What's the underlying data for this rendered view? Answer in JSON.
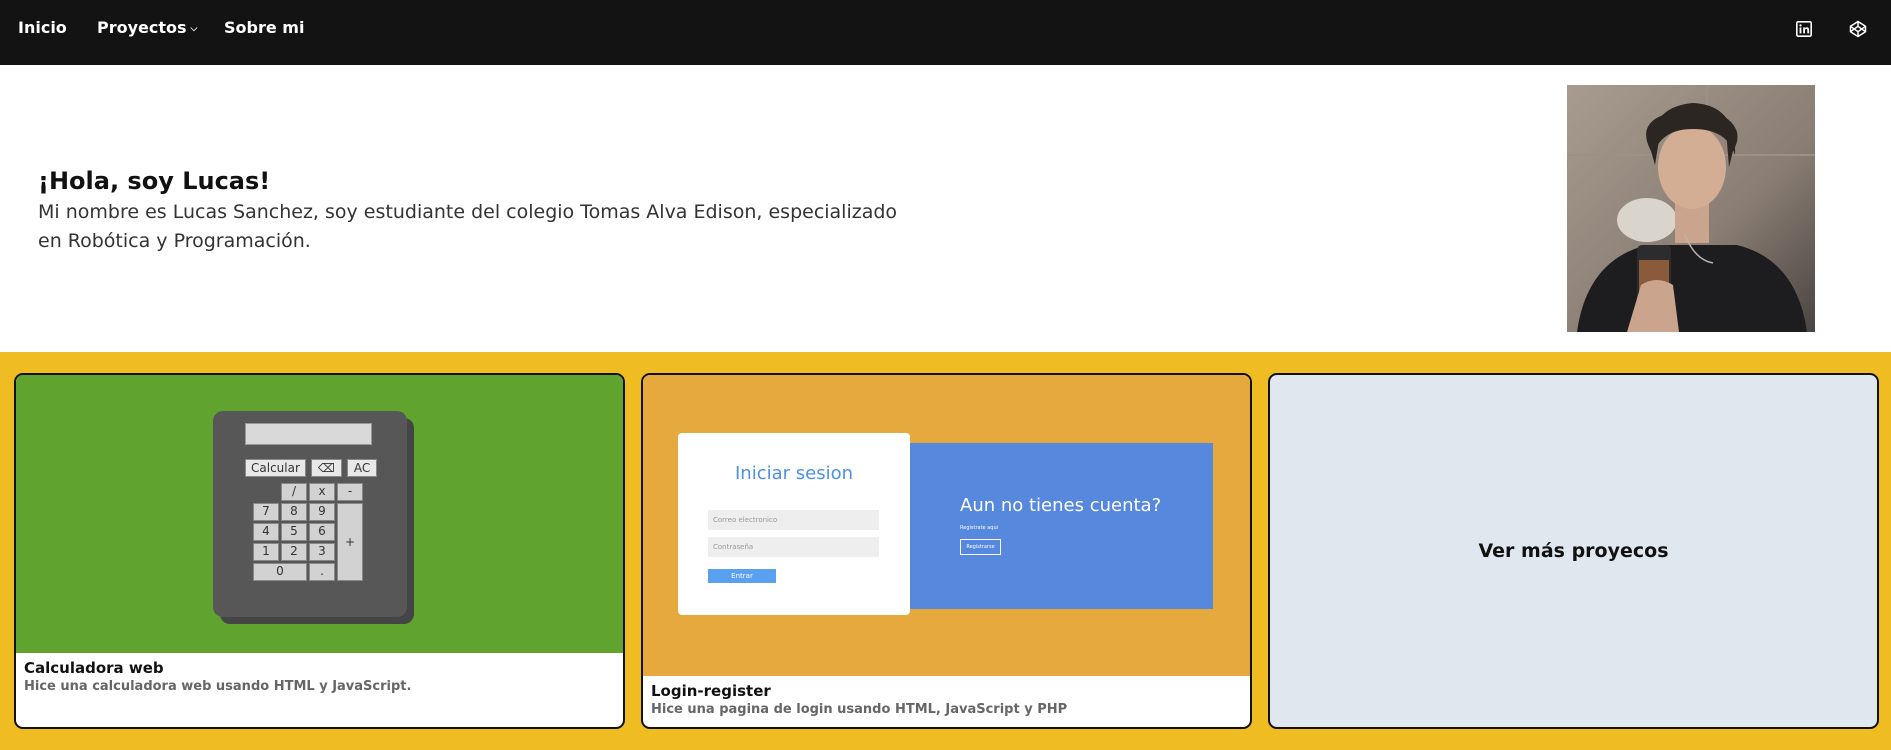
{
  "nav": {
    "home": "Inicio",
    "projects": "Proyectos",
    "about": "Sobre mi",
    "icons": [
      "linkedin-icon",
      "codepen-icon"
    ]
  },
  "hero": {
    "title": "¡Hola, soy Lucas!",
    "description": "Mi nombre es Lucas Sanchez, soy estudiante del colegio Tomas Alva Edison, especializado en Robótica y Programación."
  },
  "cards": [
    {
      "title": "Calculadora web",
      "description": "Hice una calculadora web usando HTML y JavaScript.",
      "calc": {
        "buttons_top": [
          "Calcular",
          "⌫",
          "AC"
        ],
        "ops": [
          "/",
          "x",
          "-",
          "+"
        ],
        "digits": [
          "7",
          "8",
          "9",
          "4",
          "5",
          "6",
          "1",
          "2",
          "3",
          "0",
          "."
        ]
      }
    },
    {
      "title": "Login-register",
      "description": "Hice una pagina de login usando HTML, JavaScript y PHP",
      "login": {
        "heading": "Iniciar sesion",
        "email_placeholder": "Correo electronico",
        "password_placeholder": "Contraseña",
        "submit": "Entrar",
        "side_heading": "Aun no tienes cuenta?",
        "side_text": "Registrate aqui",
        "side_button": "Registrarse"
      }
    }
  ],
  "more": "Ver más proyecos",
  "colors": {
    "nav_bg": "#131313",
    "band": "#efbd21",
    "calc_bg": "#60a32f",
    "login_bg": "#e5a93d",
    "login_blue": "#5688dd",
    "more_bg": "#e1e7ef"
  }
}
